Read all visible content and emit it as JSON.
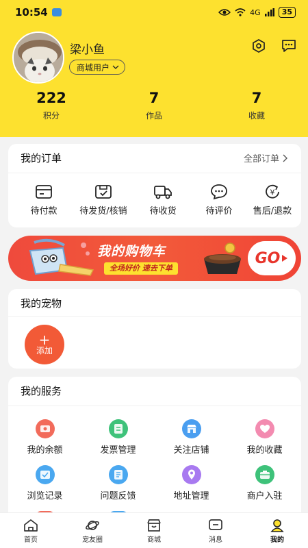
{
  "status_bar": {
    "time": "10:54",
    "signal_text": "4G",
    "battery": "35"
  },
  "profile": {
    "name": "梁小鱼",
    "role_tag": "商城用户",
    "icons": [
      "settings-icon",
      "message-icon"
    ]
  },
  "stats": [
    {
      "value": "222",
      "label": "积分"
    },
    {
      "value": "7",
      "label": "作品"
    },
    {
      "value": "7",
      "label": "收藏"
    }
  ],
  "orders": {
    "title": "我的订单",
    "all_label": "全部订单",
    "items": [
      {
        "label": "待付款",
        "icon": "wallet-icon"
      },
      {
        "label": "待发货/核销",
        "icon": "package-check-icon"
      },
      {
        "label": "待收货",
        "icon": "truck-icon"
      },
      {
        "label": "待评价",
        "icon": "comment-icon"
      },
      {
        "label": "售后/退款",
        "icon": "refund-icon"
      }
    ]
  },
  "banner": {
    "title": "我的购物车",
    "subtitle": "全场好价 速去下单",
    "go_label": "GO"
  },
  "pets": {
    "title": "我的宠物",
    "add_plus": "+",
    "add_label": "添加"
  },
  "services": {
    "title": "我的服务",
    "items": [
      {
        "label": "我的余额",
        "icon": "balance-icon",
        "color": "#f26b5b"
      },
      {
        "label": "发票管理",
        "icon": "invoice-icon",
        "color": "#3ec27a"
      },
      {
        "label": "关注店铺",
        "icon": "store-icon",
        "color": "#4a9ef0"
      },
      {
        "label": "我的收藏",
        "icon": "favorite-icon",
        "color": "#f38bb0"
      },
      {
        "label": "浏览记录",
        "icon": "history-icon",
        "color": "#4aa8f0"
      },
      {
        "label": "问题反馈",
        "icon": "feedback-icon",
        "color": "#4aa8f0"
      },
      {
        "label": "地址管理",
        "icon": "location-icon",
        "color": "#a87af0"
      },
      {
        "label": "商户入驻",
        "icon": "merchant-icon",
        "color": "#3ec27a"
      }
    ]
  },
  "tabs": [
    {
      "label": "首页",
      "icon": "home-icon"
    },
    {
      "label": "宠友圈",
      "icon": "planet-icon"
    },
    {
      "label": "商城",
      "icon": "shop-icon"
    },
    {
      "label": "消息",
      "icon": "message-icon"
    },
    {
      "label": "我的",
      "icon": "profile-icon",
      "active": true
    }
  ],
  "colors": {
    "brand_yellow": "#fde12f",
    "accent_red": "#f25a37"
  }
}
